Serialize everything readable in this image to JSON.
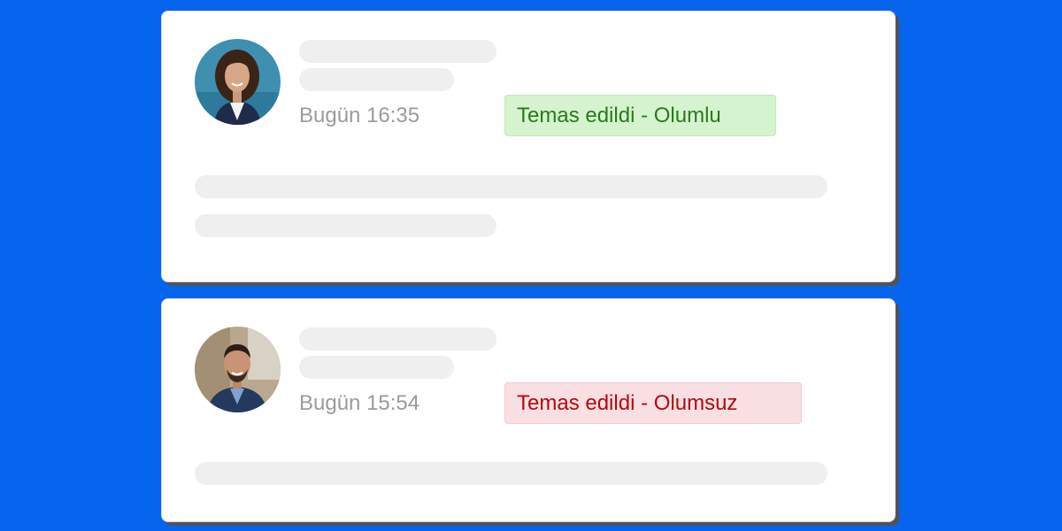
{
  "contacts": [
    {
      "avatar_icon": "person-avatar-woman-icon",
      "time": "Bugün 16:35",
      "status": "Temas edildi - Olumlu",
      "status_color": "#2a7a1c",
      "status_bg": "#d5f3cf"
    },
    {
      "avatar_icon": "person-avatar-man-icon",
      "time": "Bugün 15:54",
      "status": "Temas edildi - Olumsuz",
      "status_color": "#b00b12",
      "status_bg": "#f9dfe1"
    }
  ],
  "colors": {
    "background": "#0565ee",
    "card": "#ffffff",
    "skeleton": "#efefef",
    "timestamp": "#9b9b9b"
  }
}
